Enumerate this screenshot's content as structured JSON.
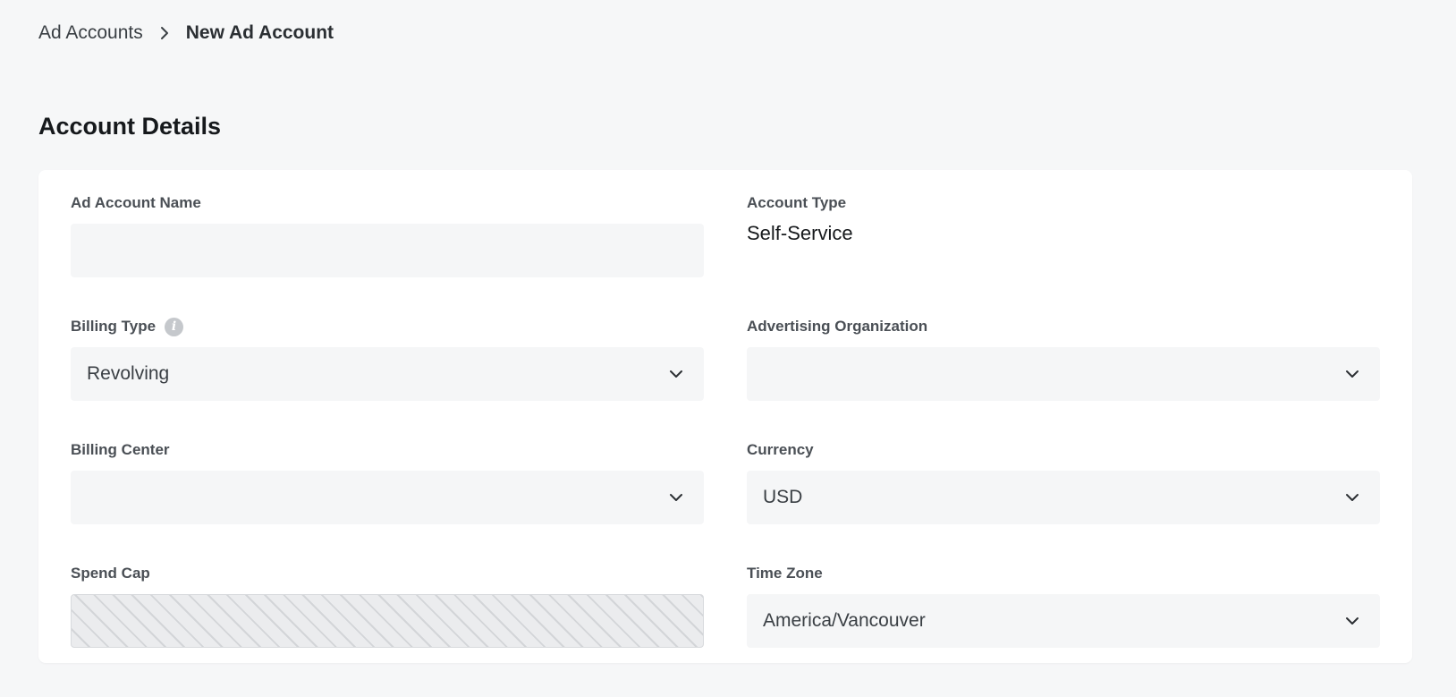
{
  "breadcrumb": {
    "parent_label": "Ad Accounts",
    "separator_icon": "chevron-right-icon",
    "current_label": "New Ad Account"
  },
  "section": {
    "title": "Account Details"
  },
  "form": {
    "ad_account_name": {
      "label": "Ad Account Name",
      "value": "",
      "placeholder": ""
    },
    "account_type": {
      "label": "Account Type",
      "value": "Self-Service"
    },
    "billing_type": {
      "label": "Billing Type",
      "info_icon": "info-icon",
      "info_glyph": "i",
      "value": "Revolving"
    },
    "advertising_organization": {
      "label": "Advertising Organization",
      "value": ""
    },
    "billing_center": {
      "label": "Billing Center",
      "value": ""
    },
    "currency": {
      "label": "Currency",
      "value": "USD"
    },
    "spend_cap": {
      "label": "Spend Cap",
      "disabled": true
    },
    "time_zone": {
      "label": "Time Zone",
      "value": "America/Vancouver"
    }
  },
  "colors": {
    "page_background": "#f6f7f8",
    "card_background": "#ffffff",
    "field_background": "#f5f6f7",
    "label_text": "#4a4f55",
    "heading_text": "#16191c"
  }
}
